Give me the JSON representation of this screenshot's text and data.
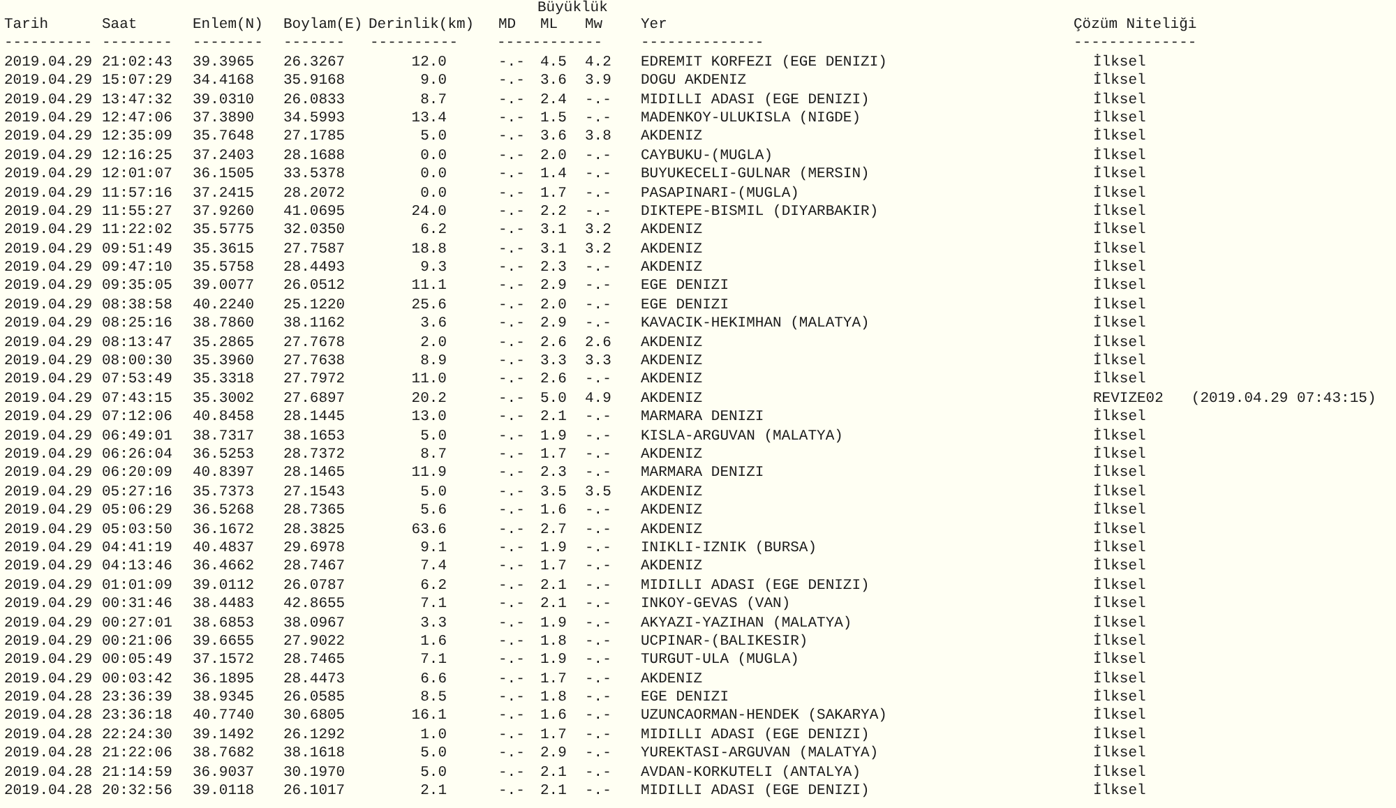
{
  "magnitude_group": "Büyüklük",
  "columns": [
    "Tarih",
    "Saat",
    "Enlem(N)",
    "Boylam(E)",
    "Derinlik(km)",
    "MD",
    "ML",
    "Mw",
    "Yer",
    "Çözüm Niteliği"
  ],
  "separators": [
    "----------",
    "--------",
    "--------",
    "-------",
    "----------",
    "------------",
    "--------------",
    "--------------"
  ],
  "rows": [
    {
      "date": "2019.04.29",
      "time": "21:02:43",
      "lat": "39.3965",
      "lon": "26.3267",
      "depth": "12.0",
      "md": "-.-",
      "ml": "4.5",
      "mw": "4.2",
      "place": "EDREMIT KORFEZI (EGE DENIZI)",
      "solution": "İlksel"
    },
    {
      "date": "2019.04.29",
      "time": "15:07:29",
      "lat": "34.4168",
      "lon": "35.9168",
      "depth": "9.0",
      "md": "-.-",
      "ml": "3.6",
      "mw": "3.9",
      "place": "DOGU AKDENIZ",
      "solution": "İlksel"
    },
    {
      "date": "2019.04.29",
      "time": "13:47:32",
      "lat": "39.0310",
      "lon": "26.0833",
      "depth": "8.7",
      "md": "-.-",
      "ml": "2.4",
      "mw": "-.-",
      "place": "MIDILLI ADASI (EGE DENIZI)",
      "solution": "İlksel"
    },
    {
      "date": "2019.04.29",
      "time": "12:47:06",
      "lat": "37.3890",
      "lon": "34.5993",
      "depth": "13.4",
      "md": "-.-",
      "ml": "1.5",
      "mw": "-.-",
      "place": "MADENKOY-ULUKISLA (NIGDE)",
      "solution": "İlksel"
    },
    {
      "date": "2019.04.29",
      "time": "12:35:09",
      "lat": "35.7648",
      "lon": "27.1785",
      "depth": "5.0",
      "md": "-.-",
      "ml": "3.6",
      "mw": "3.8",
      "place": "AKDENIZ",
      "solution": "İlksel"
    },
    {
      "date": "2019.04.29",
      "time": "12:16:25",
      "lat": "37.2403",
      "lon": "28.1688",
      "depth": "0.0",
      "md": "-.-",
      "ml": "2.0",
      "mw": "-.-",
      "place": "CAYBUKU-(MUGLA)",
      "solution": "İlksel"
    },
    {
      "date": "2019.04.29",
      "time": "12:01:07",
      "lat": "36.1505",
      "lon": "33.5378",
      "depth": "0.0",
      "md": "-.-",
      "ml": "1.4",
      "mw": "-.-",
      "place": "BUYUKECELI-GULNAR (MERSIN)",
      "solution": "İlksel"
    },
    {
      "date": "2019.04.29",
      "time": "11:57:16",
      "lat": "37.2415",
      "lon": "28.2072",
      "depth": "0.0",
      "md": "-.-",
      "ml": "1.7",
      "mw": "-.-",
      "place": "PASAPINARI-(MUGLA)",
      "solution": "İlksel"
    },
    {
      "date": "2019.04.29",
      "time": "11:55:27",
      "lat": "37.9260",
      "lon": "41.0695",
      "depth": "24.0",
      "md": "-.-",
      "ml": "2.2",
      "mw": "-.-",
      "place": "DIKTEPE-BISMIL (DIYARBAKIR)",
      "solution": "İlksel"
    },
    {
      "date": "2019.04.29",
      "time": "11:22:02",
      "lat": "35.5775",
      "lon": "32.0350",
      "depth": "6.2",
      "md": "-.-",
      "ml": "3.1",
      "mw": "3.2",
      "place": "AKDENIZ",
      "solution": "İlksel"
    },
    {
      "date": "2019.04.29",
      "time": "09:51:49",
      "lat": "35.3615",
      "lon": "27.7587",
      "depth": "18.8",
      "md": "-.-",
      "ml": "3.1",
      "mw": "3.2",
      "place": "AKDENIZ",
      "solution": "İlksel"
    },
    {
      "date": "2019.04.29",
      "time": "09:47:10",
      "lat": "35.5758",
      "lon": "28.4493",
      "depth": "9.3",
      "md": "-.-",
      "ml": "2.3",
      "mw": "-.-",
      "place": "AKDENIZ",
      "solution": "İlksel"
    },
    {
      "date": "2019.04.29",
      "time": "09:35:05",
      "lat": "39.0077",
      "lon": "26.0512",
      "depth": "11.1",
      "md": "-.-",
      "ml": "2.9",
      "mw": "-.-",
      "place": "EGE DENIZI",
      "solution": "İlksel"
    },
    {
      "date": "2019.04.29",
      "time": "08:38:58",
      "lat": "40.2240",
      "lon": "25.1220",
      "depth": "25.6",
      "md": "-.-",
      "ml": "2.0",
      "mw": "-.-",
      "place": "EGE DENIZI",
      "solution": "İlksel"
    },
    {
      "date": "2019.04.29",
      "time": "08:25:16",
      "lat": "38.7860",
      "lon": "38.1162",
      "depth": "3.6",
      "md": "-.-",
      "ml": "2.9",
      "mw": "-.-",
      "place": "KAVACIK-HEKIMHAN (MALATYA)",
      "solution": "İlksel"
    },
    {
      "date": "2019.04.29",
      "time": "08:13:47",
      "lat": "35.2865",
      "lon": "27.7678",
      "depth": "2.0",
      "md": "-.-",
      "ml": "2.6",
      "mw": "2.6",
      "place": "AKDENIZ",
      "solution": "İlksel"
    },
    {
      "date": "2019.04.29",
      "time": "08:00:30",
      "lat": "35.3960",
      "lon": "27.7638",
      "depth": "8.9",
      "md": "-.-",
      "ml": "3.3",
      "mw": "3.3",
      "place": "AKDENIZ",
      "solution": "İlksel"
    },
    {
      "date": "2019.04.29",
      "time": "07:53:49",
      "lat": "35.3318",
      "lon": "27.7972",
      "depth": "11.0",
      "md": "-.-",
      "ml": "2.6",
      "mw": "-.-",
      "place": "AKDENIZ",
      "solution": "İlksel"
    },
    {
      "date": "2019.04.29",
      "time": "07:43:15",
      "lat": "35.3002",
      "lon": "27.6897",
      "depth": "20.2",
      "md": "-.-",
      "ml": "5.0",
      "mw": "4.9",
      "place": "AKDENIZ",
      "solution": "REVIZE02",
      "revision_time": "(2019.04.29 07:43:15)"
    },
    {
      "date": "2019.04.29",
      "time": "07:12:06",
      "lat": "40.8458",
      "lon": "28.1445",
      "depth": "13.0",
      "md": "-.-",
      "ml": "2.1",
      "mw": "-.-",
      "place": "MARMARA DENIZI",
      "solution": "İlksel"
    },
    {
      "date": "2019.04.29",
      "time": "06:49:01",
      "lat": "38.7317",
      "lon": "38.1653",
      "depth": "5.0",
      "md": "-.-",
      "ml": "1.9",
      "mw": "-.-",
      "place": "KISLA-ARGUVAN (MALATYA)",
      "solution": "İlksel"
    },
    {
      "date": "2019.04.29",
      "time": "06:26:04",
      "lat": "36.5253",
      "lon": "28.7372",
      "depth": "8.7",
      "md": "-.-",
      "ml": "1.7",
      "mw": "-.-",
      "place": "AKDENIZ",
      "solution": "İlksel"
    },
    {
      "date": "2019.04.29",
      "time": "06:20:09",
      "lat": "40.8397",
      "lon": "28.1465",
      "depth": "11.9",
      "md": "-.-",
      "ml": "2.3",
      "mw": "-.-",
      "place": "MARMARA DENIZI",
      "solution": "İlksel"
    },
    {
      "date": "2019.04.29",
      "time": "05:27:16",
      "lat": "35.7373",
      "lon": "27.1543",
      "depth": "5.0",
      "md": "-.-",
      "ml": "3.5",
      "mw": "3.5",
      "place": "AKDENIZ",
      "solution": "İlksel"
    },
    {
      "date": "2019.04.29",
      "time": "05:06:29",
      "lat": "36.5268",
      "lon": "28.7365",
      "depth": "5.6",
      "md": "-.-",
      "ml": "1.6",
      "mw": "-.-",
      "place": "AKDENIZ",
      "solution": "İlksel"
    },
    {
      "date": "2019.04.29",
      "time": "05:03:50",
      "lat": "36.1672",
      "lon": "28.3825",
      "depth": "63.6",
      "md": "-.-",
      "ml": "2.7",
      "mw": "-.-",
      "place": "AKDENIZ",
      "solution": "İlksel"
    },
    {
      "date": "2019.04.29",
      "time": "04:41:19",
      "lat": "40.4837",
      "lon": "29.6978",
      "depth": "9.1",
      "md": "-.-",
      "ml": "1.9",
      "mw": "-.-",
      "place": "INIKLI-IZNIK (BURSA)",
      "solution": "İlksel"
    },
    {
      "date": "2019.04.29",
      "time": "04:13:46",
      "lat": "36.4662",
      "lon": "28.7467",
      "depth": "7.4",
      "md": "-.-",
      "ml": "1.7",
      "mw": "-.-",
      "place": "AKDENIZ",
      "solution": "İlksel"
    },
    {
      "date": "2019.04.29",
      "time": "01:01:09",
      "lat": "39.0112",
      "lon": "26.0787",
      "depth": "6.2",
      "md": "-.-",
      "ml": "2.1",
      "mw": "-.-",
      "place": "MIDILLI ADASI (EGE DENIZI)",
      "solution": "İlksel"
    },
    {
      "date": "2019.04.29",
      "time": "00:31:46",
      "lat": "38.4483",
      "lon": "42.8655",
      "depth": "7.1",
      "md": "-.-",
      "ml": "2.1",
      "mw": "-.-",
      "place": "INKOY-GEVAS (VAN)",
      "solution": "İlksel"
    },
    {
      "date": "2019.04.29",
      "time": "00:27:01",
      "lat": "38.6853",
      "lon": "38.0967",
      "depth": "3.3",
      "md": "-.-",
      "ml": "1.9",
      "mw": "-.-",
      "place": "AKYAZI-YAZIHAN (MALATYA)",
      "solution": "İlksel"
    },
    {
      "date": "2019.04.29",
      "time": "00:21:06",
      "lat": "39.6655",
      "lon": "27.9022",
      "depth": "1.6",
      "md": "-.-",
      "ml": "1.8",
      "mw": "-.-",
      "place": "UCPINAR-(BALIKESIR)",
      "solution": "İlksel"
    },
    {
      "date": "2019.04.29",
      "time": "00:05:49",
      "lat": "37.1572",
      "lon": "28.7465",
      "depth": "7.1",
      "md": "-.-",
      "ml": "1.9",
      "mw": "-.-",
      "place": "TURGUT-ULA (MUGLA)",
      "solution": "İlksel"
    },
    {
      "date": "2019.04.29",
      "time": "00:03:42",
      "lat": "36.1895",
      "lon": "28.4473",
      "depth": "6.6",
      "md": "-.-",
      "ml": "1.7",
      "mw": "-.-",
      "place": "AKDENIZ",
      "solution": "İlksel"
    },
    {
      "date": "2019.04.28",
      "time": "23:36:39",
      "lat": "38.9345",
      "lon": "26.0585",
      "depth": "8.5",
      "md": "-.-",
      "ml": "1.8",
      "mw": "-.-",
      "place": "EGE DENIZI",
      "solution": "İlksel"
    },
    {
      "date": "2019.04.28",
      "time": "23:36:18",
      "lat": "40.7740",
      "lon": "30.6805",
      "depth": "16.1",
      "md": "-.-",
      "ml": "1.6",
      "mw": "-.-",
      "place": "UZUNCAORMAN-HENDEK (SAKARYA)",
      "solution": "İlksel"
    },
    {
      "date": "2019.04.28",
      "time": "22:24:30",
      "lat": "39.1492",
      "lon": "26.1292",
      "depth": "1.0",
      "md": "-.-",
      "ml": "1.7",
      "mw": "-.-",
      "place": "MIDILLI ADASI (EGE DENIZI)",
      "solution": "İlksel"
    },
    {
      "date": "2019.04.28",
      "time": "21:22:06",
      "lat": "38.7682",
      "lon": "38.1618",
      "depth": "5.0",
      "md": "-.-",
      "ml": "2.9",
      "mw": "-.-",
      "place": "YUREKTASI-ARGUVAN (MALATYA)",
      "solution": "İlksel"
    },
    {
      "date": "2019.04.28",
      "time": "21:14:59",
      "lat": "36.9037",
      "lon": "30.1970",
      "depth": "5.0",
      "md": "-.-",
      "ml": "2.1",
      "mw": "-.-",
      "place": "AVDAN-KORKUTELI (ANTALYA)",
      "solution": "İlksel"
    },
    {
      "date": "2019.04.28",
      "time": "20:32:56",
      "lat": "39.0118",
      "lon": "26.1017",
      "depth": "2.1",
      "md": "-.-",
      "ml": "2.1",
      "mw": "-.-",
      "place": "MIDILLI ADASI (EGE DENIZI)",
      "solution": "İlksel"
    }
  ]
}
